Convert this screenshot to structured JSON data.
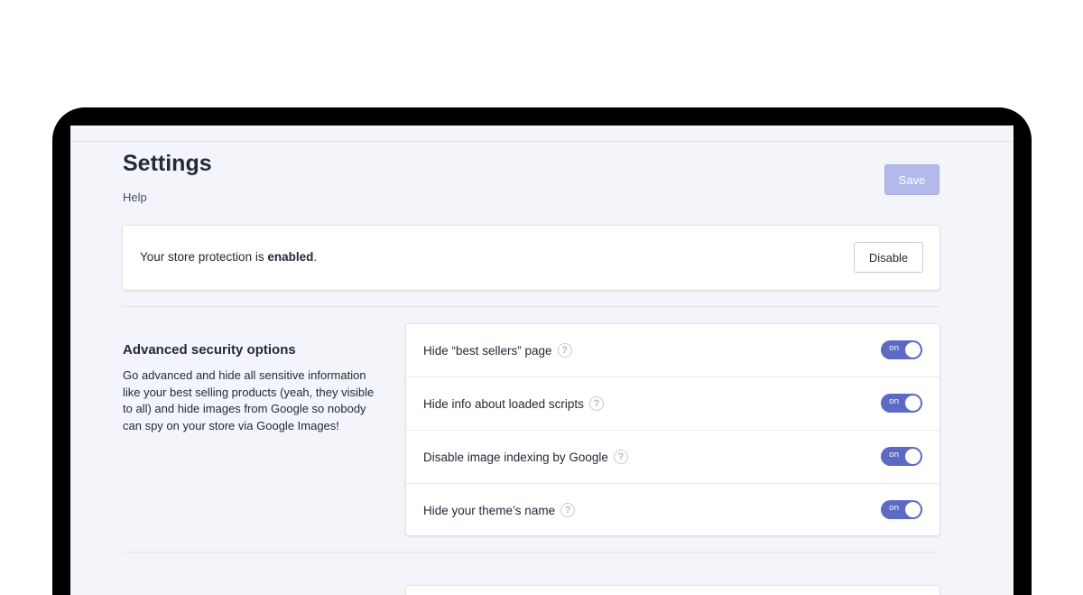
{
  "header": {
    "title": "Settings",
    "help_link": "Help",
    "save_label": "Save"
  },
  "status": {
    "prefix": "Your store protection is ",
    "state": "enabled",
    "suffix": ".",
    "disable_label": "Disable"
  },
  "advanced": {
    "title": "Advanced security options",
    "description": "Go advanced and hide all sensitive information like your best selling products (yeah, they visible to all) and hide images from Google so nobody can spy on your store via Google Images!",
    "options": [
      {
        "label": "Hide “best sellers” page",
        "toggle": "on",
        "enabled": true
      },
      {
        "label": "Hide info about loaded scripts",
        "toggle": "on",
        "enabled": true
      },
      {
        "label": "Disable image indexing by Google",
        "toggle": "on",
        "enabled": true
      },
      {
        "label": "Hide your theme’s name",
        "toggle": "on",
        "enabled": true
      }
    ]
  },
  "icons": {
    "help": "question-circle-icon"
  },
  "colors": {
    "accent": "#5c6ac4",
    "save_disabled": "#b4b9ec",
    "background": "#f4f5fa"
  }
}
